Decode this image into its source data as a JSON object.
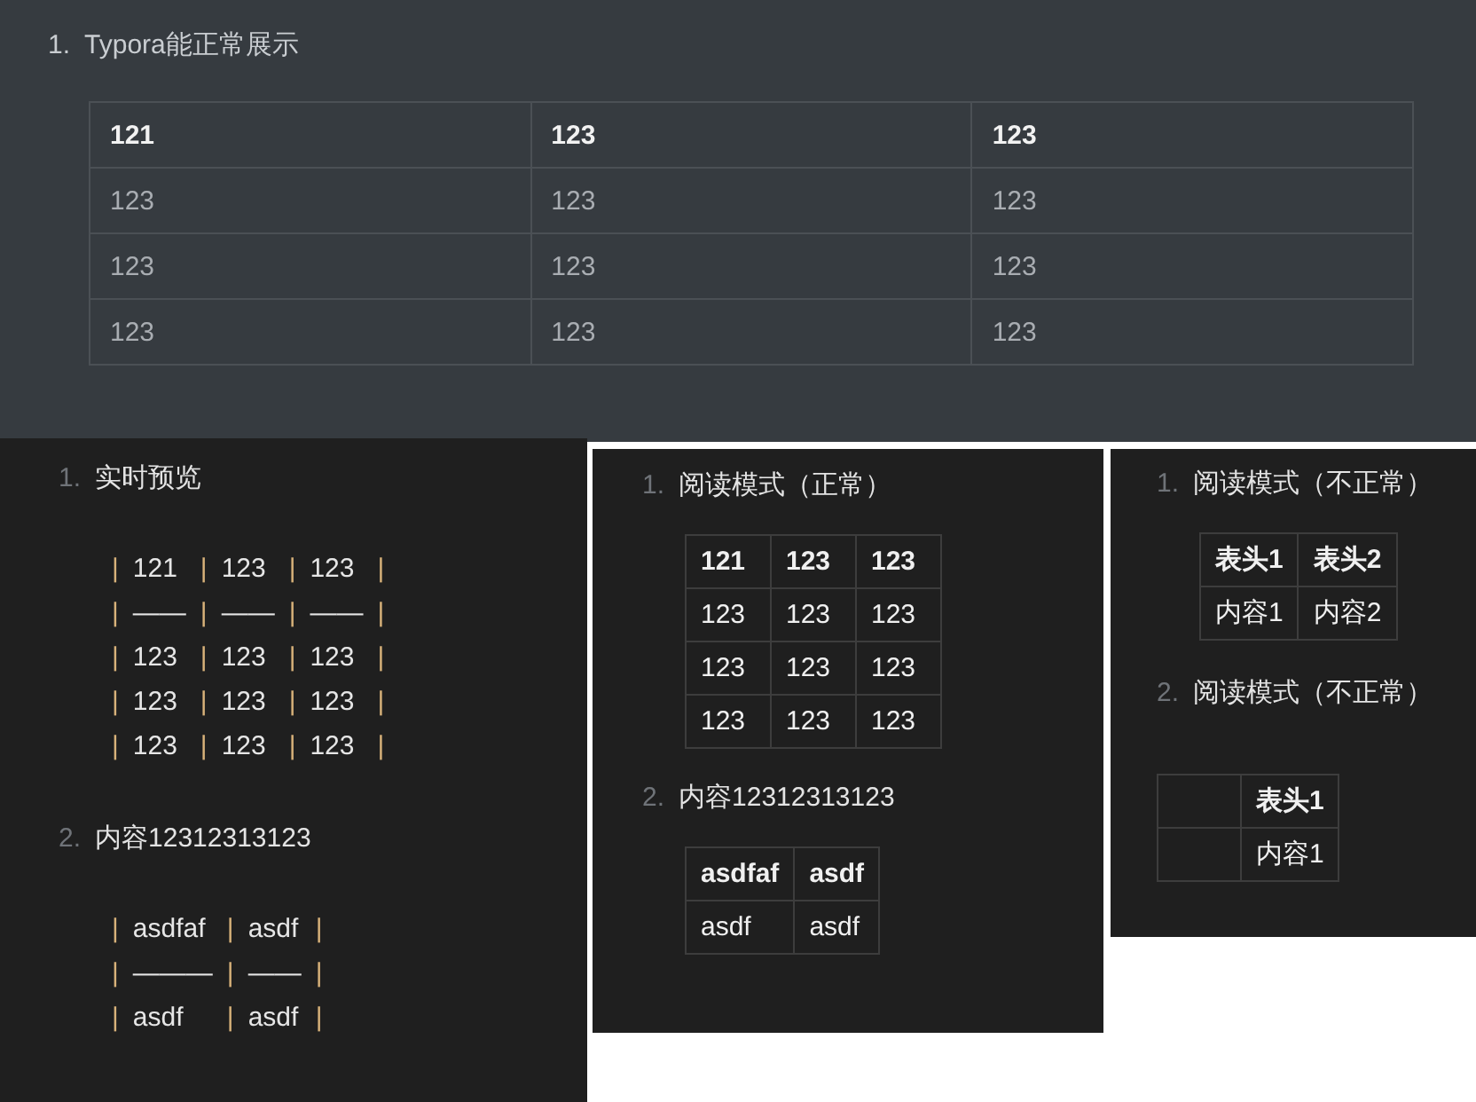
{
  "panels": [
    {
      "kind": "wide",
      "items": [
        {
          "number": "1.",
          "title": "Typora能正常展示",
          "table": {
            "header": [
              "121",
              "123",
              "123"
            ],
            "rows": [
              [
                "123",
                "123",
                "123"
              ],
              [
                "123",
                "123",
                "123"
              ],
              [
                "123",
                "123",
                "123"
              ]
            ]
          }
        }
      ]
    },
    {
      "kind": "source",
      "items": [
        {
          "number": "1.",
          "title": "实时预览",
          "source": {
            "separator": "|",
            "lines": [
              [
                "121",
                "123",
                "123"
              ],
              [
                "——",
                "——",
                "——"
              ],
              [
                "123",
                "123",
                "123"
              ],
              [
                "123",
                "123",
                "123"
              ],
              [
                "123",
                "123",
                "123"
              ]
            ]
          }
        },
        {
          "number": "2.",
          "title": "内容12312313123",
          "source": {
            "separator": "|",
            "lines": [
              [
                "asdfaf",
                "asdf"
              ],
              [
                "———",
                "——"
              ],
              [
                "asdf",
                "asdf"
              ]
            ]
          }
        }
      ]
    },
    {
      "kind": "reading",
      "items": [
        {
          "number": "1.",
          "title": "阅读模式（正常）",
          "table": {
            "header": [
              "121",
              "123",
              "123"
            ],
            "rows": [
              [
                "123",
                "123",
                "123"
              ],
              [
                "123",
                "123",
                "123"
              ],
              [
                "123",
                "123",
                "123"
              ]
            ]
          }
        },
        {
          "number": "2.",
          "title": "内容12312313123",
          "table": {
            "header": [
              "asdfaf",
              "asdf"
            ],
            "rows": [
              [
                "asdf",
                "asdf"
              ]
            ]
          }
        }
      ]
    },
    {
      "kind": "reading",
      "items": [
        {
          "number": "1.",
          "title": "阅读模式（不正常）",
          "table": {
            "header": [
              "表头1",
              "表头2"
            ],
            "rows": [
              [
                "内容1",
                "内容2"
              ]
            ]
          }
        },
        {
          "number": "2.",
          "title": "阅读模式（不正常）",
          "table": {
            "blank_first_column": true,
            "header": [
              "表头1"
            ],
            "rows": [
              [
                "内容1"
              ]
            ]
          }
        }
      ]
    }
  ]
}
